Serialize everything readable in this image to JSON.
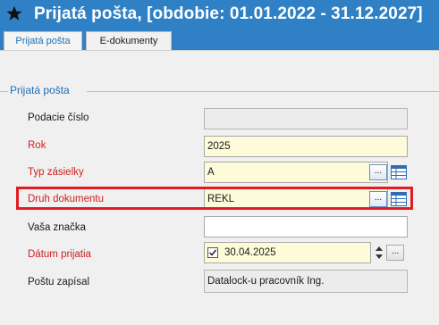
{
  "window": {
    "title": "Prijatá pošta, [obdobie: 01.01.2022 - 31.12.2027]",
    "icon": "star-icon"
  },
  "tabs": [
    {
      "label": "Prijatá pošta",
      "active": true
    },
    {
      "label": "E-dokumenty",
      "active": false
    }
  ],
  "section": {
    "title": "Prijatá pošta"
  },
  "form": {
    "podacie_cislo": {
      "label": "Podacie číslo",
      "value": "",
      "required": false
    },
    "rok": {
      "label": "Rok",
      "value": "2025",
      "required": true
    },
    "typ_zasielky": {
      "label": "Typ zásielky",
      "value": "A",
      "required": true,
      "lookup_button": "..."
    },
    "druh_dokumentu": {
      "label": "Druh dokumentu",
      "value": "REKL",
      "required": true,
      "lookup_button": "...",
      "highlighted": true
    },
    "vasa_znacka": {
      "label": "Vaša značka",
      "value": "",
      "required": false
    },
    "datum_prijatia": {
      "label": "Dátum prijatia",
      "value": "30.04.2025",
      "required": true,
      "checked": true,
      "calendar_button": "..."
    },
    "postu_zapisal": {
      "label": "Poštu zapísal",
      "value": "Datalock-u pracovník Ing.",
      "required": false
    }
  },
  "colors": {
    "accent": "#2f80c4",
    "required_label": "#d02020",
    "highlight_border": "#e31b23",
    "mandatory_field_bg": "#fdfbd9"
  }
}
